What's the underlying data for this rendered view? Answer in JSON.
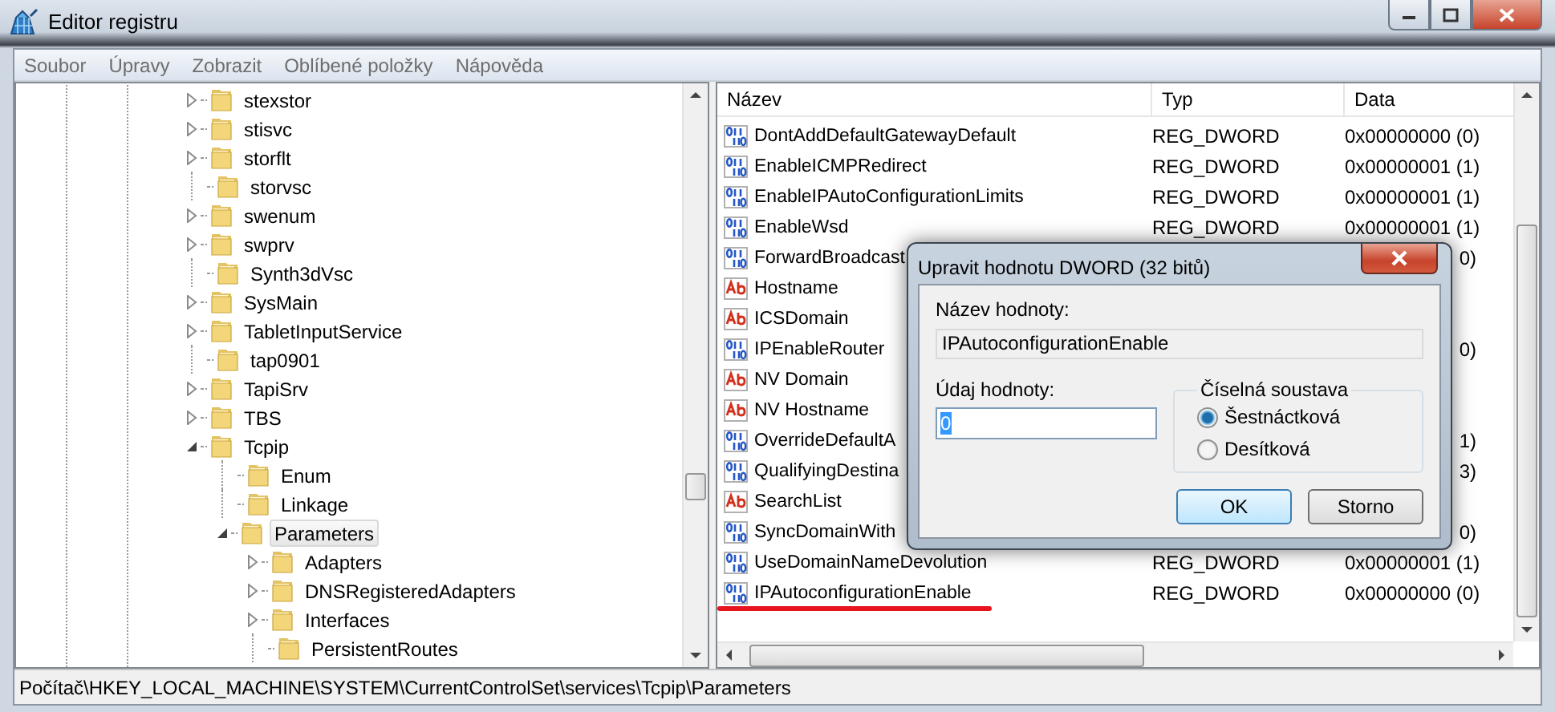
{
  "window": {
    "title": "Editor registru"
  },
  "menu": [
    "Soubor",
    "Úpravy",
    "Zobrazit",
    "Oblíbené položky",
    "Nápověda"
  ],
  "tree": [
    {
      "label": "stexstor",
      "kind": "branch",
      "expanded": false,
      "selected": false
    },
    {
      "label": "stisvc",
      "kind": "branch",
      "expanded": false,
      "selected": false
    },
    {
      "label": "storflt",
      "kind": "branch",
      "expanded": false,
      "selected": false
    },
    {
      "label": "storvsc",
      "kind": "leaf",
      "selected": false
    },
    {
      "label": "swenum",
      "kind": "branch",
      "expanded": false,
      "selected": false
    },
    {
      "label": "swprv",
      "kind": "branch",
      "expanded": false,
      "selected": false
    },
    {
      "label": "Synth3dVsc",
      "kind": "leaf",
      "selected": false
    },
    {
      "label": "SysMain",
      "kind": "branch",
      "expanded": false,
      "selected": false
    },
    {
      "label": "TabletInputService",
      "kind": "branch",
      "expanded": false,
      "selected": false
    },
    {
      "label": "tap0901",
      "kind": "leaf",
      "selected": false
    },
    {
      "label": "TapiSrv",
      "kind": "branch",
      "expanded": false,
      "selected": false
    },
    {
      "label": "TBS",
      "kind": "branch",
      "expanded": false,
      "selected": false
    },
    {
      "label": "Tcpip",
      "kind": "branch",
      "expanded": true,
      "selected": false,
      "children": [
        {
          "label": "Enum",
          "kind": "leaf",
          "selected": false
        },
        {
          "label": "Linkage",
          "kind": "leaf",
          "selected": false
        },
        {
          "label": "Parameters",
          "kind": "branch",
          "expanded": true,
          "selected": true,
          "children": [
            {
              "label": "Adapters",
              "kind": "branch",
              "expanded": false,
              "selected": false
            },
            {
              "label": "DNSRegisteredAdapters",
              "kind": "branch",
              "expanded": false,
              "selected": false
            },
            {
              "label": "Interfaces",
              "kind": "branch",
              "expanded": false,
              "selected": false
            },
            {
              "label": "PersistentRoutes",
              "kind": "leaf",
              "selected": false
            }
          ]
        }
      ]
    }
  ],
  "list": {
    "columns": [
      "Název",
      "Typ",
      "Data"
    ],
    "rows": [
      {
        "kind": "dword",
        "name": "DontAddDefaultGatewayDefault",
        "type": "REG_DWORD",
        "data": "0x00000000 (0)",
        "underlined": false
      },
      {
        "kind": "dword",
        "name": "EnableICMPRedirect",
        "type": "REG_DWORD",
        "data": "0x00000001 (1)",
        "underlined": false
      },
      {
        "kind": "dword",
        "name": "EnableIPAutoConfigurationLimits",
        "type": "REG_DWORD",
        "data": "0x00000001 (1)",
        "underlined": false
      },
      {
        "kind": "dword",
        "name": "EnableWsd",
        "type": "REG_DWORD",
        "data": "0x00000001 (1)",
        "underlined": false
      },
      {
        "kind": "dword",
        "name": "ForwardBroadcast",
        "data": "0)",
        "underlined": false
      },
      {
        "kind": "string",
        "name": "Hostname",
        "underlined": false
      },
      {
        "kind": "string",
        "name": "ICSDomain",
        "underlined": false
      },
      {
        "kind": "dword",
        "name": "IPEnableRouter",
        "data": "0)",
        "underlined": false
      },
      {
        "kind": "string",
        "name": "NV Domain",
        "underlined": false
      },
      {
        "kind": "string",
        "name": "NV Hostname",
        "underlined": false
      },
      {
        "kind": "dword",
        "name": "OverrideDefaultA",
        "data": "1)",
        "underlined": false
      },
      {
        "kind": "dword",
        "name": "QualifyingDestina",
        "data": "3)",
        "underlined": false
      },
      {
        "kind": "string",
        "name": "SearchList",
        "underlined": false
      },
      {
        "kind": "dword",
        "name": "SyncDomainWith",
        "data": "0)",
        "underlined": false
      },
      {
        "kind": "dword",
        "name": "UseDomainNameDevolution",
        "type": "REG_DWORD",
        "data": "0x00000001 (1)",
        "underlined": false
      },
      {
        "kind": "dword",
        "name": "IPAutoconfigurationEnable",
        "type": "REG_DWORD",
        "data": "0x00000000 (0)",
        "underlined": true
      }
    ]
  },
  "dialog": {
    "title": "Upravit hodnotu DWORD (32 bitů)",
    "name_label": "Název hodnoty:",
    "name_value": "IPAutoconfigurationEnable",
    "data_label": "Údaj hodnoty:",
    "data_value": "0",
    "base_group": "Číselná soustava",
    "bases": [
      {
        "label": "Šestnáctková",
        "selected": true
      },
      {
        "label": "Desítková",
        "selected": false
      }
    ],
    "buttons": [
      {
        "label": "OK",
        "default": true
      },
      {
        "label": "Storno",
        "default": false
      }
    ]
  },
  "status_bar": "Počítač\\HKEY_LOCAL_MACHINE\\SYSTEM\\CurrentControlSet\\services\\Tcpip\\Parameters"
}
